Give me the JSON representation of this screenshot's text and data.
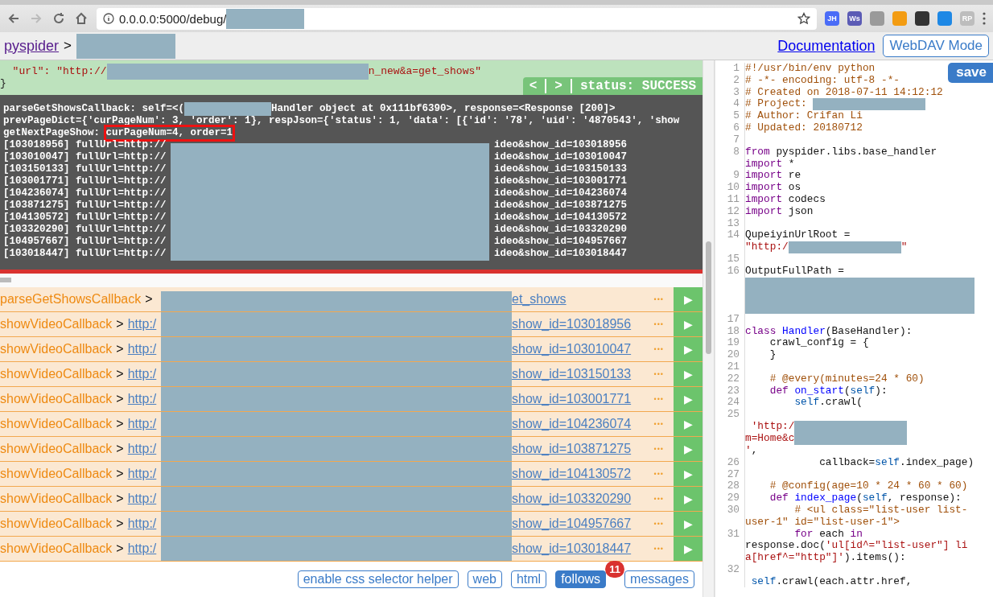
{
  "browser": {
    "url": "0.0.0.0:5000/debug/",
    "extensions": [
      {
        "label": "JH",
        "color": "#4a6cf7"
      },
      {
        "label": "Ws",
        "color": "#5b5bb5"
      },
      {
        "color": "#9a9a9a"
      },
      {
        "color": "#f39c12"
      },
      {
        "color": "#333333"
      },
      {
        "color": "#1e88e5"
      },
      {
        "label": "RP",
        "color": "#bdbdbd"
      }
    ]
  },
  "header": {
    "brand": "pyspider",
    "separator": ">",
    "links": [
      "Documentation"
    ],
    "mode_button": "WebDAV Mode"
  },
  "response": {
    "lines": [
      {
        "before": "  \"url\": \"http://",
        "after": "n_new&a=get_shows\""
      },
      {
        "before": "}"
      }
    ],
    "nav_prev": "<",
    "nav_next": ">",
    "status": "status: SUCCESS"
  },
  "log": {
    "lines": [
      {
        "segs": [
          {
            "kind": "text",
            "text": "parseGetShowsCallback: self=<("
          },
          {
            "kind": "redacted"
          },
          {
            "kind": "text",
            "text": "Handler object at 0x111bf6390>, response=<Response [200]>"
          }
        ]
      },
      {
        "segs": [
          {
            "kind": "text",
            "text": "prevPageDict={'curPageNum': 3, 'order': 1}, respJson={'status': 1, 'data': [{'id': '78', 'uid': '4870543', 'show"
          }
        ]
      },
      {
        "segs": [
          {
            "kind": "text",
            "text": "getNextPageShow: "
          },
          {
            "kind": "boxed",
            "text": "curPageNum=4, order=1"
          }
        ]
      }
    ],
    "url_lines": [
      {
        "prefix": "[103018956] fullUrl=http://",
        "suffix": "ideo&show_id=103018956"
      },
      {
        "prefix": "[103010047] fullUrl=http://",
        "suffix": "ideo&show_id=103010047"
      },
      {
        "prefix": "[103150133] fullUrl=http://",
        "suffix": "ideo&show_id=103150133"
      },
      {
        "prefix": "[103001771] fullUrl=http://",
        "suffix": "ideo&show_id=103001771"
      },
      {
        "prefix": "[104236074] fullUrl=http://",
        "suffix": "ideo&show_id=104236074"
      },
      {
        "prefix": "[103871275] fullUrl=http://",
        "suffix": "ideo&show_id=103871275"
      },
      {
        "prefix": "[104130572] fullUrl=http://",
        "suffix": "ideo&show_id=104130572"
      },
      {
        "prefix": "[103320290] fullUrl=http://",
        "suffix": "ideo&show_id=103320290"
      },
      {
        "prefix": "[104957667] fullUrl=http://",
        "suffix": "ideo&show_id=104957667"
      },
      {
        "prefix": "[103018447] fullUrl=http://",
        "suffix": "ideo&show_id=103018447"
      }
    ]
  },
  "follows": [
    {
      "callback": "parseGetShowsCallback",
      "separator": ">",
      "link_end": "et_shows",
      "more": "•••",
      "run": "▶"
    },
    {
      "callback": "showVideoCallback",
      "separator": ">",
      "link_start": "http:/",
      "link_end": "show_id=103018956",
      "more": "•••",
      "run": "▶"
    },
    {
      "callback": "showVideoCallback",
      "separator": ">",
      "link_start": "http:/",
      "link_end": "show_id=103010047",
      "more": "•••",
      "run": "▶"
    },
    {
      "callback": "showVideoCallback",
      "separator": ">",
      "link_start": "http:/",
      "link_end": "show_id=103150133",
      "more": "•••",
      "run": "▶"
    },
    {
      "callback": "showVideoCallback",
      "separator": ">",
      "link_start": "http:/",
      "link_end": "show_id=103001771",
      "more": "•••",
      "run": "▶"
    },
    {
      "callback": "showVideoCallback",
      "separator": ">",
      "link_start": "http:/",
      "link_end": "show_id=104236074",
      "more": "•••",
      "run": "▶"
    },
    {
      "callback": "showVideoCallback",
      "separator": ">",
      "link_start": "http:/",
      "link_end": "show_id=103871275",
      "more": "•••",
      "run": "▶"
    },
    {
      "callback": "showVideoCallback",
      "separator": ">",
      "link_start": "http:/",
      "link_end": "show_id=104130572",
      "more": "•••",
      "run": "▶"
    },
    {
      "callback": "showVideoCallback",
      "separator": ">",
      "link_start": "http:/",
      "link_end": "show_id=103320290",
      "more": "•••",
      "run": "▶"
    },
    {
      "callback": "showVideoCallback",
      "separator": ">",
      "link_start": "http:/",
      "link_end": "show_id=104957667",
      "more": "•••",
      "run": "▶"
    },
    {
      "callback": "showVideoCallback",
      "separator": ">",
      "link_start": "http:/",
      "link_end": "show_id=103018447",
      "more": "•••",
      "run": "▶"
    }
  ],
  "bottom_tabs": [
    {
      "label": "enable css selector helper",
      "selected": false
    },
    {
      "label": "web",
      "selected": false
    },
    {
      "label": "html",
      "selected": false
    },
    {
      "label": "follows",
      "selected": true,
      "badge": "11"
    },
    {
      "label": "messages",
      "selected": false
    }
  ],
  "editor": {
    "save": "save",
    "rows": [
      {
        "num": "1",
        "segs": [
          {
            "kind": "comment",
            "text": "#!/usr/bin/env python"
          }
        ]
      },
      {
        "num": "2",
        "segs": [
          {
            "kind": "comment",
            "text": "# -*- encoding: utf-8 -*-"
          }
        ]
      },
      {
        "num": "3",
        "segs": [
          {
            "kind": "comment",
            "text": "# Created on 2018-07-11 14:12:12"
          }
        ]
      },
      {
        "num": "4",
        "segs": [
          {
            "kind": "comment",
            "text": "# Project: "
          },
          {
            "kind": "redacted"
          }
        ]
      },
      {
        "num": "5",
        "segs": [
          {
            "kind": "comment",
            "text": "# Author: Crifan Li"
          }
        ]
      },
      {
        "num": "6",
        "segs": [
          {
            "kind": "comment",
            "text": "# Updated: 20180712"
          }
        ]
      },
      {
        "num": "7",
        "segs": []
      },
      {
        "num": "8",
        "segs": [
          {
            "kind": "keyword",
            "text": "from"
          },
          {
            "kind": "plain",
            "text": " pyspider.libs.base_handler"
          }
        ]
      },
      {
        "segs": [
          {
            "kind": "keyword",
            "text": "import"
          },
          {
            "kind": "plain",
            "text": " *"
          }
        ]
      },
      {
        "num": "9",
        "segs": [
          {
            "kind": "keyword",
            "text": "import"
          },
          {
            "kind": "plain",
            "text": " re"
          }
        ]
      },
      {
        "num": "10",
        "segs": [
          {
            "kind": "keyword",
            "text": "import"
          },
          {
            "kind": "plain",
            "text": " os"
          }
        ]
      },
      {
        "num": "11",
        "segs": [
          {
            "kind": "keyword",
            "text": "import"
          },
          {
            "kind": "plain",
            "text": " codecs"
          }
        ]
      },
      {
        "num": "12",
        "segs": [
          {
            "kind": "keyword",
            "text": "import"
          },
          {
            "kind": "plain",
            "text": " json"
          }
        ]
      },
      {
        "num": "13",
        "segs": []
      },
      {
        "num": "14",
        "segs": [
          {
            "kind": "plain",
            "text": "QupeiyinUrlRoot ="
          }
        ]
      },
      {
        "segs": [
          {
            "kind": "string",
            "text": "\"http:/"
          },
          {
            "kind": "redacted"
          },
          {
            "kind": "string",
            "text": "\""
          }
        ]
      },
      {
        "num": "15",
        "segs": []
      },
      {
        "num": "16",
        "segs": [
          {
            "kind": "plain",
            "text": "OutputFullPath ="
          }
        ]
      },
      {
        "segs": [
          {
            "kind": "redacted_block"
          }
        ]
      },
      {
        "num": "17",
        "segs": []
      },
      {
        "num": "18",
        "segs": [
          {
            "kind": "keyword",
            "text": "class "
          },
          {
            "kind": "def",
            "text": "Handler"
          },
          {
            "kind": "plain",
            "text": "(BaseHandler):"
          }
        ]
      },
      {
        "num": "19",
        "segs": [
          {
            "kind": "plain",
            "text": "    crawl_config = {"
          }
        ]
      },
      {
        "num": "20",
        "segs": [
          {
            "kind": "plain",
            "text": "    }"
          }
        ]
      },
      {
        "num": "21",
        "segs": []
      },
      {
        "num": "22",
        "segs": [
          {
            "kind": "comment",
            "text": "    # @every(minutes=24 * 60)"
          }
        ]
      },
      {
        "num": "23",
        "segs": [
          {
            "kind": "keyword",
            "text": "    def "
          },
          {
            "kind": "def",
            "text": "on_start"
          },
          {
            "kind": "plain",
            "text": "("
          },
          {
            "kind": "variable",
            "text": "self"
          },
          {
            "kind": "plain",
            "text": "):"
          }
        ]
      },
      {
        "num": "24",
        "segs": [
          {
            "kind": "variable",
            "text": "        self"
          },
          {
            "kind": "plain",
            "text": ".crawl("
          }
        ]
      },
      {
        "num": "25",
        "segs": []
      },
      {
        "segs": [
          {
            "kind": "string",
            "text": " 'http:/"
          },
          {
            "kind": "redacted"
          }
        ]
      },
      {
        "segs": [
          {
            "kind": "string",
            "text": "m=Home&c"
          },
          {
            "kind": "redacted"
          }
        ]
      },
      {
        "segs": [
          {
            "kind": "string",
            "text": "'"
          },
          {
            "kind": "plain",
            "text": ","
          }
        ]
      },
      {
        "num": "26",
        "segs": [
          {
            "kind": "plain",
            "text": "            callback="
          },
          {
            "kind": "variable",
            "text": "self"
          },
          {
            "kind": "plain",
            "text": ".index_page)"
          }
        ]
      },
      {
        "num": "27",
        "segs": []
      },
      {
        "num": "28",
        "segs": [
          {
            "kind": "comment",
            "text": "    # @config(age=10 * 24 * 60 * 60)"
          }
        ]
      },
      {
        "num": "29",
        "segs": [
          {
            "kind": "keyword",
            "text": "    def "
          },
          {
            "kind": "def",
            "text": "index_page"
          },
          {
            "kind": "plain",
            "text": "("
          },
          {
            "kind": "variable",
            "text": "self"
          },
          {
            "kind": "plain",
            "text": ", response):"
          }
        ]
      },
      {
        "num": "30",
        "segs": [
          {
            "kind": "comment",
            "text": "        # <ul class=\"list-user list-"
          }
        ]
      },
      {
        "segs": [
          {
            "kind": "comment",
            "text": "user-1\" id=\"list-user-1\">"
          }
        ]
      },
      {
        "num": "31",
        "segs": [
          {
            "kind": "keyword",
            "text": "        for"
          },
          {
            "kind": "plain",
            "text": " each "
          },
          {
            "kind": "keyword",
            "text": "in"
          }
        ]
      },
      {
        "segs": [
          {
            "kind": "plain",
            "text": "response.doc("
          },
          {
            "kind": "string",
            "text": "'ul[id^=\"list-user\"] li"
          }
        ]
      },
      {
        "segs": [
          {
            "kind": "string",
            "text": "a[href^=\"http\"]'"
          },
          {
            "kind": "plain",
            "text": ").items():"
          }
        ]
      },
      {
        "num": "32",
        "segs": []
      },
      {
        "segs": [
          {
            "kind": "variable",
            "text": " self"
          },
          {
            "kind": "plain",
            "text": ".crawl(each.attr.href,"
          }
        ]
      }
    ]
  }
}
